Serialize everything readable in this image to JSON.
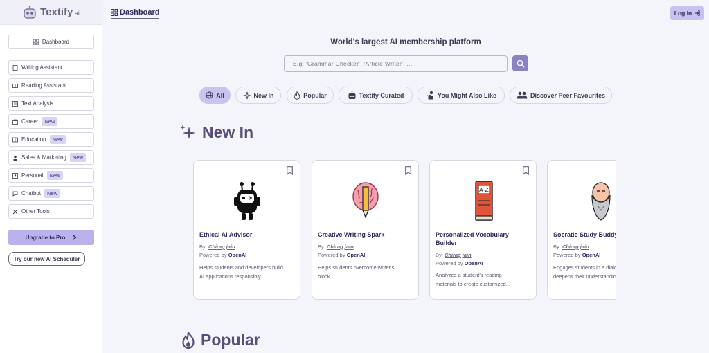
{
  "app": {
    "name": "Textify",
    "suffix": ".ai"
  },
  "sidebar": {
    "dashboard": "Dashboard",
    "items": [
      {
        "label": "Writing Assistant",
        "badge": ""
      },
      {
        "label": "Reading Assistant",
        "badge": ""
      },
      {
        "label": "Text Analysis",
        "badge": ""
      },
      {
        "label": "Career",
        "badge": "New"
      },
      {
        "label": "Education",
        "badge": "New"
      },
      {
        "label": "Sales & Marketing",
        "badge": "New"
      },
      {
        "label": "Personal",
        "badge": "New"
      },
      {
        "label": "Chatbot",
        "badge": "New"
      },
      {
        "label": "Other Tools",
        "badge": ""
      }
    ],
    "upgrade": "Upgrade to Pro",
    "scheduler": "Try our new AI Scheduler"
  },
  "header": {
    "tab": "Dashboard",
    "login": "Log In"
  },
  "main": {
    "tagline": "World's largest AI membership platform",
    "search_placeholder": "E.g: 'Grammar Checker', 'Article Writer', ...",
    "filters": [
      "All",
      "New In",
      "Popular",
      "Textify Curated",
      "You Might Also Like",
      "Discover Peer Favourites"
    ],
    "sections": {
      "new_in": "New In",
      "popular": "Popular"
    },
    "cards": [
      {
        "title": "Ethical AI Advisor",
        "title2": "",
        "by_label": "By:",
        "author": "Chirag jain",
        "powered_label": "Powered by",
        "powered": "OpenAI",
        "desc1": "Helps students and developers build",
        "desc2": "AI applications responsibly."
      },
      {
        "title": "Creative Writing Spark",
        "title2": "",
        "by_label": "By:",
        "author": "Chirag jain",
        "powered_label": "Powered by",
        "powered": "OpenAI",
        "desc1": "Helps students overcome writer's",
        "desc2": "block."
      },
      {
        "title": "Personalized Vocabulary",
        "title2": "Builder",
        "by_label": "By:",
        "author": "Chirag jain",
        "powered_label": "Powered by",
        "powered": "OpenAI",
        "desc1": "Analyzes a student's reading",
        "desc2": "materials to create customized..."
      },
      {
        "title": "Socratic Study Buddy",
        "title2": "",
        "by_label": "By:",
        "author": "Chirag jain",
        "powered_label": "Powered by",
        "powered": "OpenAI",
        "desc1": "Engages students in a dialogue that",
        "desc2": "deepens their understanding"
      }
    ]
  },
  "colors": {
    "accent": "#8b82c2",
    "active_chip": "#c9c3ef",
    "title": "#5a4e78"
  }
}
